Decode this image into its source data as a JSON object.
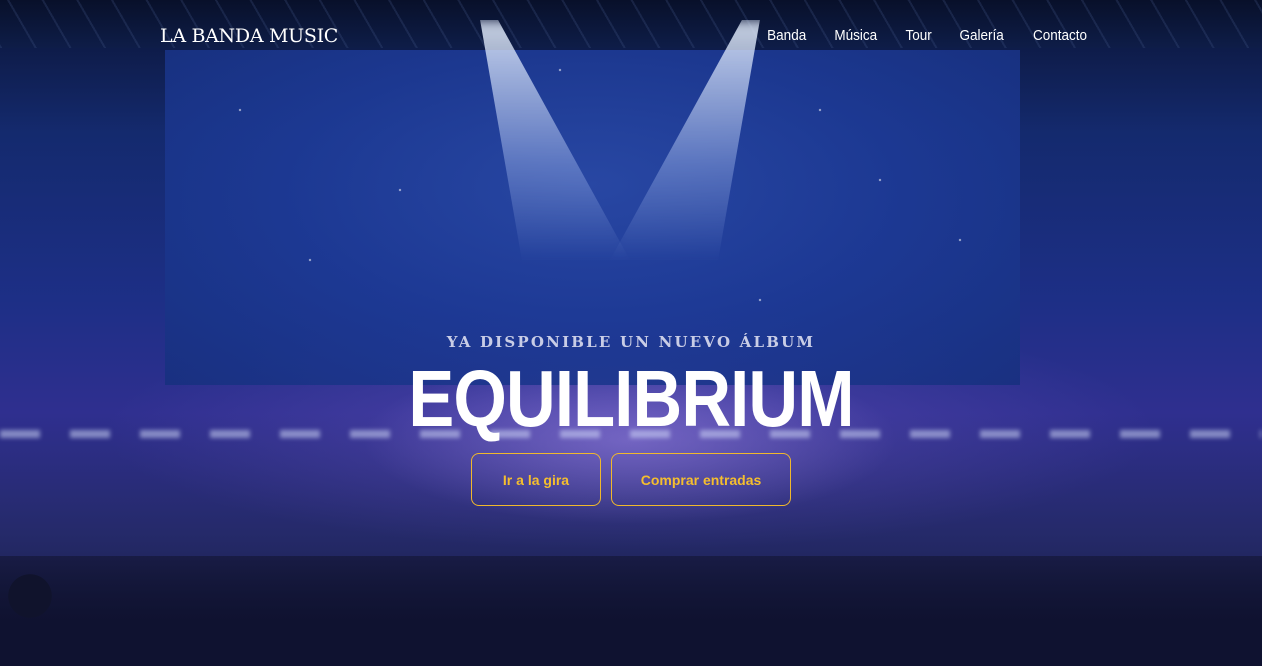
{
  "nav": {
    "logo": "LA BANDA MUSIC",
    "items": [
      "Banda",
      "Música",
      "Tour",
      "Galería",
      "Contacto"
    ]
  },
  "hero": {
    "subtitle": "YA DISPONIBLE UN NUEVO ÁLBUM",
    "title": "EQUILIBRIUM",
    "buttons": [
      "Ir a la gira",
      "Comprar entradas"
    ]
  },
  "colors": {
    "accent": "#f5be2e",
    "overlay": "#1d2f86"
  }
}
